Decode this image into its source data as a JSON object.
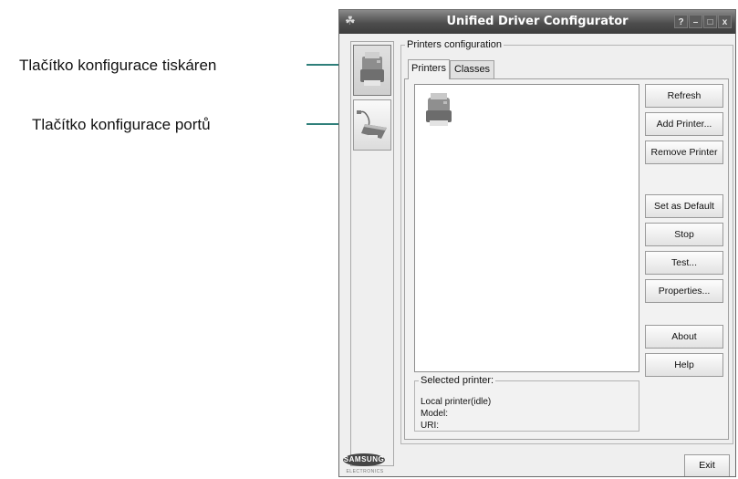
{
  "callouts": {
    "printers_config_label": "Tlačítko konfigurace tiskáren",
    "ports_config_label": "Tlačítko konfigurace portů"
  },
  "window": {
    "title": "Unified Driver Configurator",
    "title_buttons": [
      "?",
      "–",
      "□",
      "x"
    ]
  },
  "sidebar": {
    "buttons": [
      {
        "icon": "printer-icon",
        "active": true
      },
      {
        "icon": "port-icon",
        "active": false
      }
    ],
    "logo_text": "SAMSUNG",
    "logo_subtext": "ELECTRONICS"
  },
  "printers_config": {
    "legend": "Printers configuration",
    "tabs": [
      "Printers",
      "Classes"
    ],
    "active_tab": "Printers",
    "printer_list": [
      {
        "icon": "printer-icon"
      }
    ],
    "buttons": [
      "Refresh",
      "Add Printer...",
      "Remove Printer",
      "Set as Default",
      "Stop",
      "Test...",
      "Properties...",
      "About",
      "Help"
    ],
    "selected_printer": {
      "legend": "Selected printer:",
      "status": "Local printer(idle)",
      "model_label": "Model:",
      "uri_label": "URI:"
    }
  },
  "footer": {
    "exit_label": "Exit"
  },
  "colors": {
    "leader_line": "#2f7f7a",
    "titlebar": "#4e4e4e",
    "window_bg": "#efefef"
  }
}
